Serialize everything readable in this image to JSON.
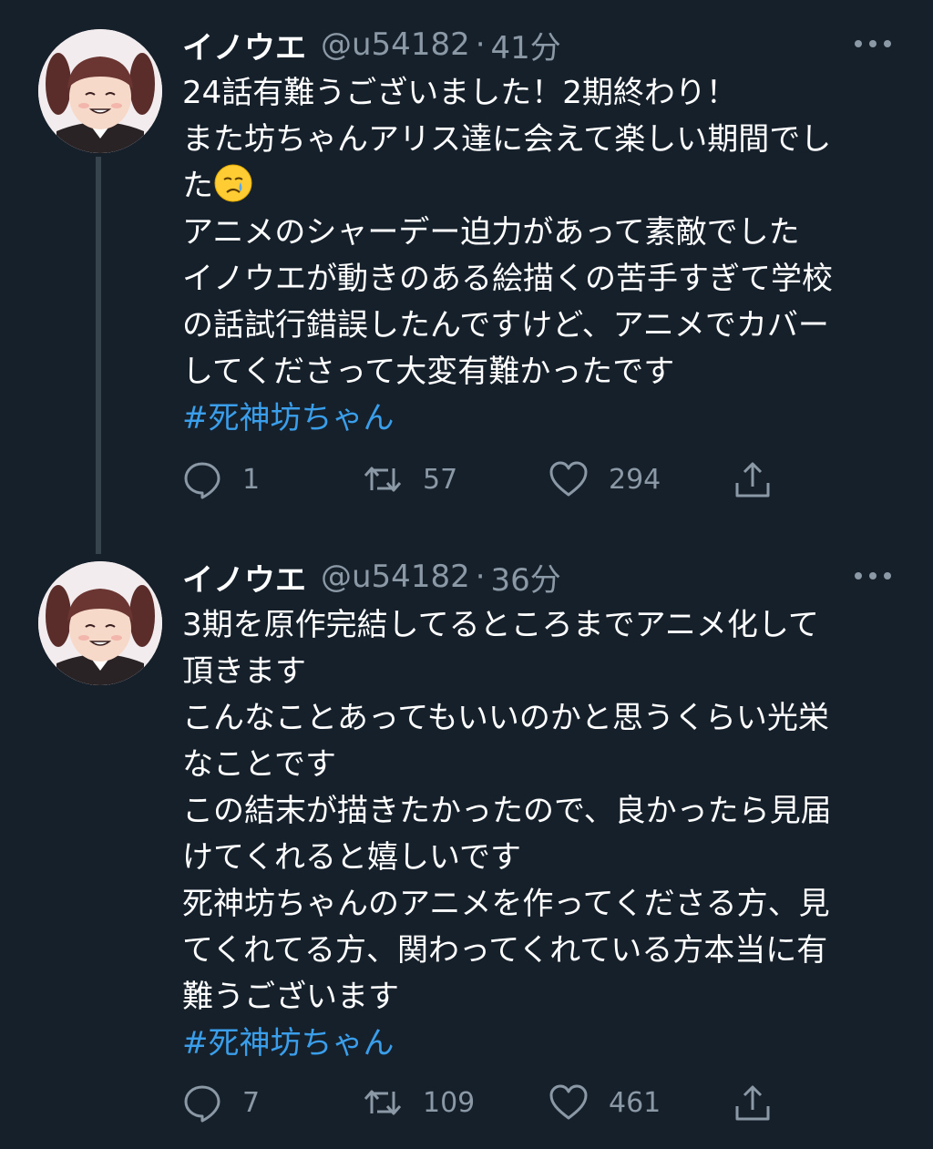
{
  "tweets": [
    {
      "author_name": "イノウエ",
      "handle": "@u54182",
      "separator": "·",
      "time": "41分",
      "lines": [
        "24話有難うございました！2期終わり！",
        "また坊ちゃんアリス達に会えて楽しい期間でし",
        "た",
        "アニメのシャーデー迫力があって素敵でした",
        "イノウエが動きのある絵描くの苦手すぎて学校",
        "の話試行錯誤したんですけど、アニメでカバー",
        "してくださって大変有難かったです"
      ],
      "hashtag": "#死神坊ちゃん",
      "emoji": "crying-face-emoji",
      "stats": {
        "replies": "1",
        "retweets": "57",
        "likes": "294"
      }
    },
    {
      "author_name": "イノウエ",
      "handle": "@u54182",
      "separator": "·",
      "time": "36分",
      "lines": [
        "3期を原作完結してるところまでアニメ化して",
        "頂きます",
        "こんなことあってもいいのかと思うくらい光栄",
        "なことです",
        "この結末が描きたかったので、良かったら見届",
        "けてくれると嬉しいです",
        "死神坊ちゃんのアニメを作ってくださる方、見",
        "てくれてる方、関わってくれている方本当に有",
        "難うございます"
      ],
      "hashtag": "#死神坊ちゃん",
      "stats": {
        "replies": "7",
        "retweets": "109",
        "likes": "461"
      }
    }
  ],
  "colors": {
    "background": "#15202b",
    "secondary_text": "#8b98a5",
    "hashtag": "#3b9eea",
    "thread_line": "#38444d"
  }
}
